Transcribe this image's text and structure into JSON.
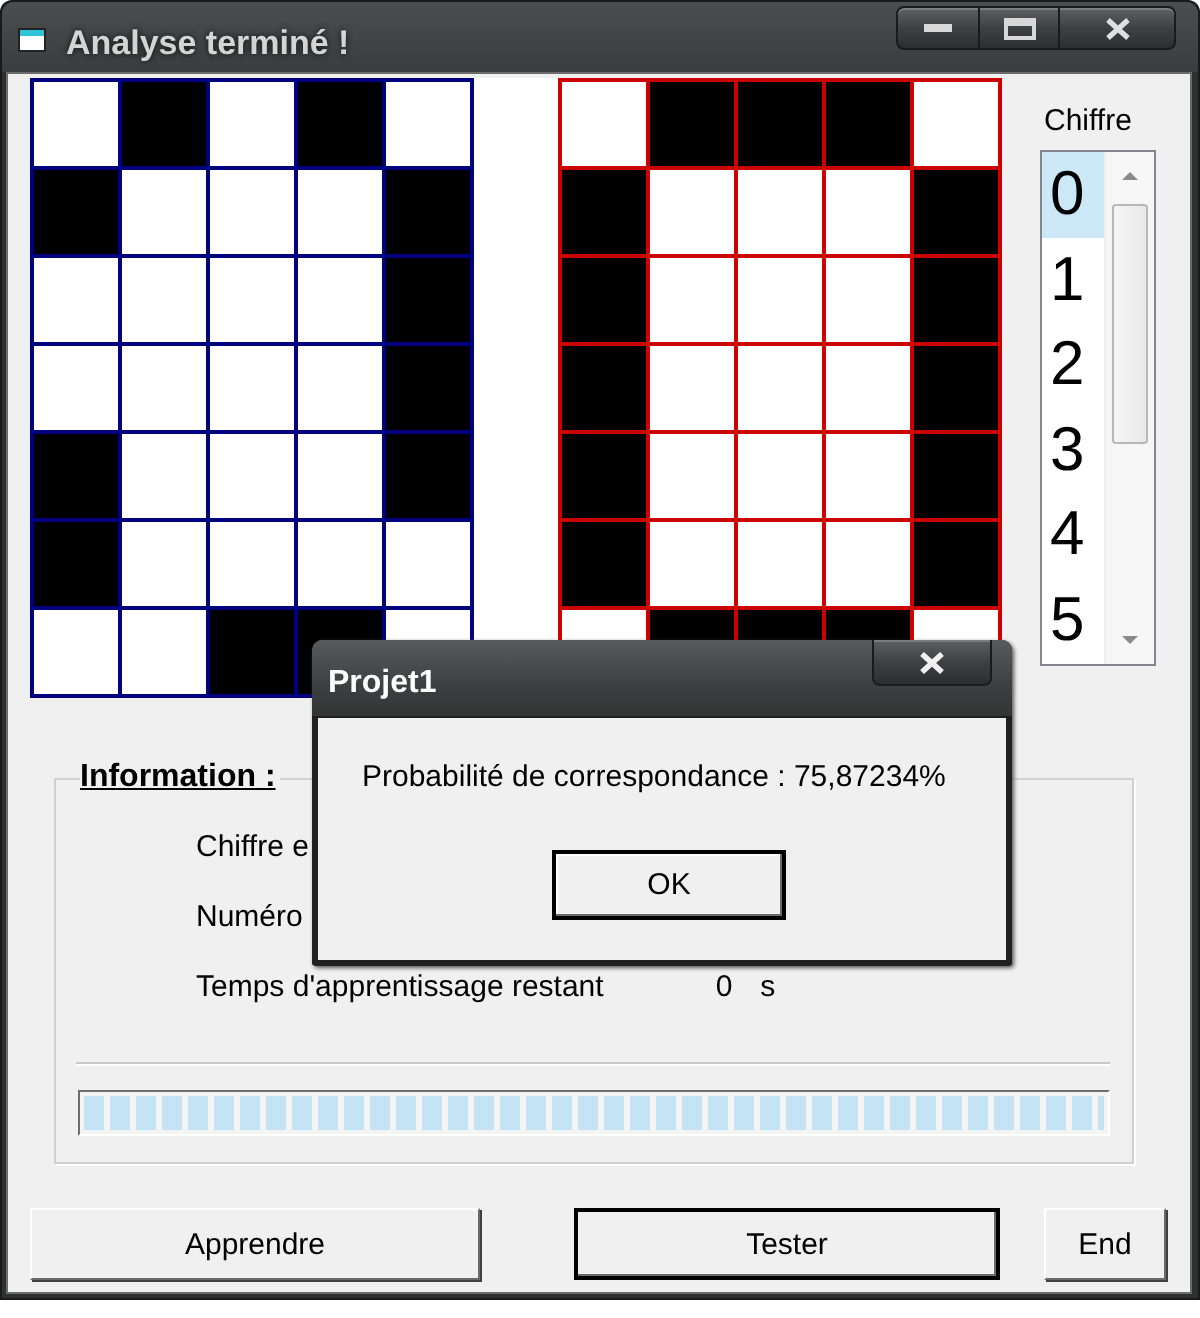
{
  "window": {
    "title": "Analyse terminé !"
  },
  "grids": [
    {
      "color": "#000080",
      "rows": [
        [
          false,
          true,
          false,
          true,
          false
        ],
        [
          true,
          false,
          false,
          false,
          true
        ],
        [
          false,
          false,
          false,
          false,
          true
        ],
        [
          false,
          false,
          false,
          false,
          true
        ],
        [
          true,
          false,
          false,
          false,
          true
        ],
        [
          true,
          false,
          false,
          false,
          false
        ],
        [
          false,
          false,
          true,
          true,
          false
        ]
      ]
    },
    {
      "color": "#cc0000",
      "rows": [
        [
          false,
          true,
          true,
          true,
          false
        ],
        [
          true,
          false,
          false,
          false,
          true
        ],
        [
          true,
          false,
          false,
          false,
          true
        ],
        [
          true,
          false,
          false,
          false,
          true
        ],
        [
          true,
          false,
          false,
          false,
          true
        ],
        [
          true,
          false,
          false,
          false,
          true
        ],
        [
          false,
          true,
          true,
          true,
          false
        ]
      ]
    }
  ],
  "digit_list": {
    "label": "Chiffre",
    "items": [
      {
        "label": "0",
        "selected": true
      },
      {
        "label": "1",
        "selected": false
      },
      {
        "label": "2",
        "selected": false
      },
      {
        "label": "3",
        "selected": false
      },
      {
        "label": "4",
        "selected": false
      },
      {
        "label": "5",
        "selected": false
      }
    ]
  },
  "information": {
    "title": "Information :",
    "rows": [
      {
        "label": "Chiffre e"
      },
      {
        "label": "Numéro"
      },
      {
        "label": "Temps d'apprentissage restant",
        "value": "0",
        "unit": "s"
      }
    ],
    "progress": {
      "level": 1
    }
  },
  "buttons": [
    {
      "label": "Apprendre",
      "default": false
    },
    {
      "label": "Tester",
      "default": true
    },
    {
      "label": "End",
      "default": false
    }
  ],
  "dialog": {
    "title": "Projet1",
    "message": "Probabilité de correspondance : 75,87234%",
    "button": "OK"
  }
}
